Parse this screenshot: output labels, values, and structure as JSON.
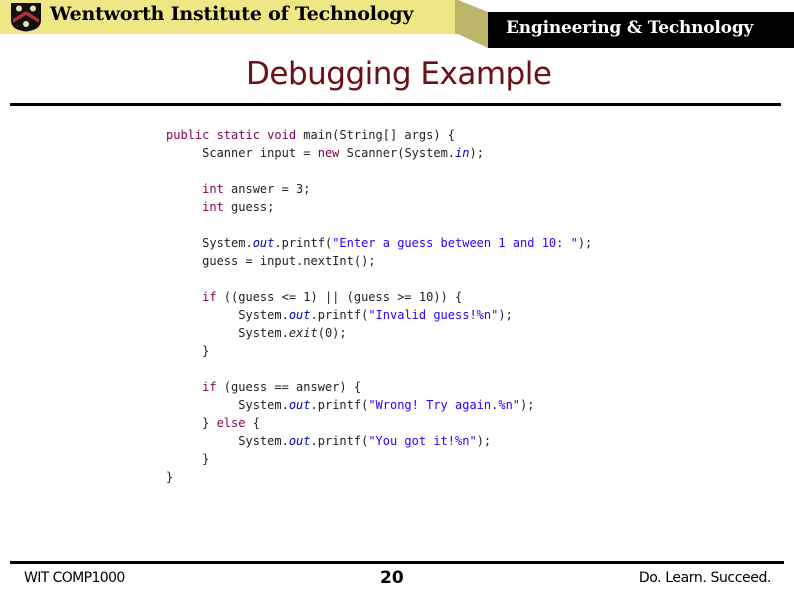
{
  "header": {
    "institution": "Wentworth Institute of Technology",
    "department": "Engineering & Technology",
    "logo_icon": "crest-shield-icon",
    "colors": {
      "banner": "#efe685",
      "dept_bar": "#000000",
      "title": "#6d0f14"
    }
  },
  "slide": {
    "title": "Debugging Example",
    "code_lines": [
      [
        {
          "t": "public static void ",
          "c": "kw"
        },
        {
          "t": "main(String[] args) {"
        }
      ],
      [
        {
          "t": "     Scanner "
        },
        {
          "t": "input",
          "c": "plain"
        },
        {
          "t": " = "
        },
        {
          "t": "new",
          "c": "kw"
        },
        {
          "t": " Scanner(System."
        },
        {
          "t": "in",
          "c": "fld"
        },
        {
          "t": ");"
        }
      ],
      [
        {
          "t": ""
        }
      ],
      [
        {
          "t": "     "
        },
        {
          "t": "int",
          "c": "kw"
        },
        {
          "t": " answer = 3;"
        }
      ],
      [
        {
          "t": "     "
        },
        {
          "t": "int",
          "c": "kw"
        },
        {
          "t": " guess;"
        }
      ],
      [
        {
          "t": ""
        }
      ],
      [
        {
          "t": "     System."
        },
        {
          "t": "out",
          "c": "fld"
        },
        {
          "t": ".printf("
        },
        {
          "t": "\"Enter a guess between 1 and 10: \"",
          "c": "str"
        },
        {
          "t": ");"
        }
      ],
      [
        {
          "t": "     guess = input.nextInt();"
        }
      ],
      [
        {
          "t": ""
        }
      ],
      [
        {
          "t": "     "
        },
        {
          "t": "if",
          "c": "kw"
        },
        {
          "t": " ((guess <= 1) || (guess >= 10)) {"
        }
      ],
      [
        {
          "t": "          System."
        },
        {
          "t": "out",
          "c": "fld"
        },
        {
          "t": ".printf("
        },
        {
          "t": "\"Invalid guess!%n\"",
          "c": "str"
        },
        {
          "t": ");"
        }
      ],
      [
        {
          "t": "          System."
        },
        {
          "t": "exit",
          "c": "it"
        },
        {
          "t": "(0);"
        }
      ],
      [
        {
          "t": "     }"
        }
      ],
      [
        {
          "t": ""
        }
      ],
      [
        {
          "t": "     "
        },
        {
          "t": "if",
          "c": "kw"
        },
        {
          "t": " (guess == answer) {"
        }
      ],
      [
        {
          "t": "          System."
        },
        {
          "t": "out",
          "c": "fld"
        },
        {
          "t": ".printf("
        },
        {
          "t": "\"Wrong! Try again.%n\"",
          "c": "str"
        },
        {
          "t": ");"
        }
      ],
      [
        {
          "t": "     } "
        },
        {
          "t": "else",
          "c": "kw"
        },
        {
          "t": " {"
        }
      ],
      [
        {
          "t": "          System."
        },
        {
          "t": "out",
          "c": "fld"
        },
        {
          "t": ".printf("
        },
        {
          "t": "\"You got it!%n\"",
          "c": "str"
        },
        {
          "t": ");"
        }
      ],
      [
        {
          "t": "     }"
        }
      ],
      [
        {
          "t": "}"
        }
      ]
    ]
  },
  "footer": {
    "course": "WIT COMP1000",
    "page_number": "20",
    "motto": "Do. Learn. Succeed."
  }
}
